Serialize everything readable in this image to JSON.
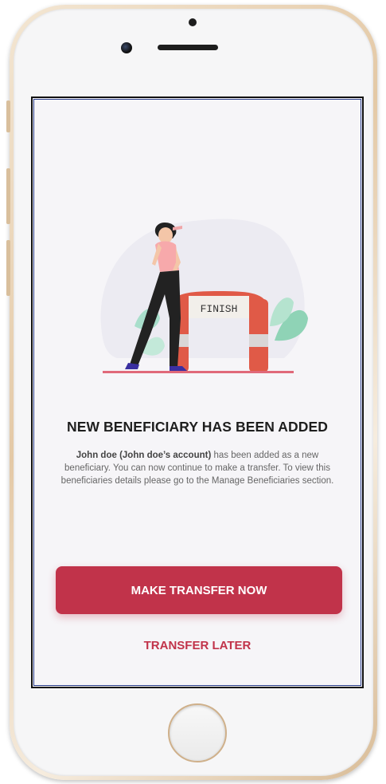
{
  "success": {
    "title": "NEW BENEFICIARY HAS BEEN ADDED",
    "desc_name": "John doe (John doe’s account)",
    "desc_text": " has been added as a new beneficiary. You can now continue to make a transfer. To view this beneficiaries details please go to the Manage Beneficiaries section.",
    "illustration_label": "FINISH"
  },
  "actions": {
    "primary_label": "MAKE TRANSFER NOW",
    "secondary_label": "TRANSFER LATER"
  },
  "colors": {
    "accent": "#c1334a",
    "background": "#f6f5f8",
    "title": "#1e1e1e"
  }
}
